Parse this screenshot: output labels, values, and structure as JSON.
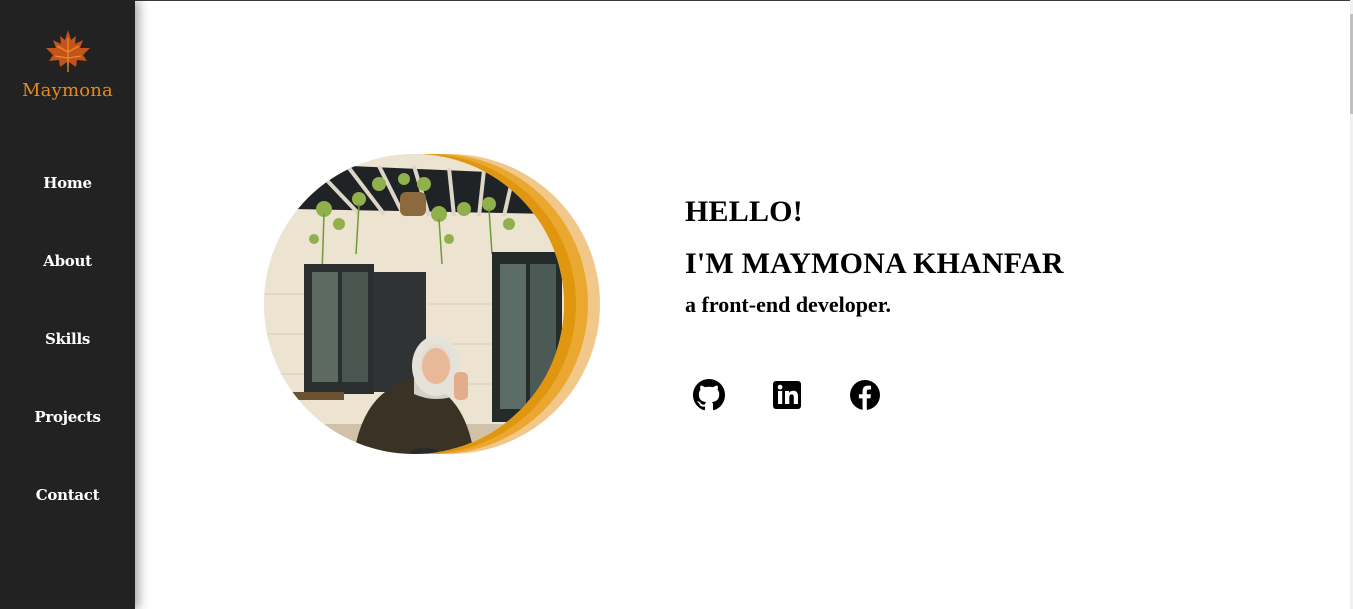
{
  "brand": {
    "name": "Maymona",
    "logo_icon": "maple-leaf-icon",
    "color": "#e8891a"
  },
  "nav": {
    "items": [
      {
        "label": "Home"
      },
      {
        "label": "About"
      },
      {
        "label": "Skills"
      },
      {
        "label": "Projects"
      },
      {
        "label": "Contact"
      }
    ]
  },
  "hero": {
    "greeting": "HELLO!",
    "name": "I'M MAYMONA KHANFAR",
    "role": "a front-end developer.",
    "photo_icon": "profile-photo",
    "accent_colors": [
      "#e0960f",
      "#eba830",
      "#f2c78a"
    ]
  },
  "socials": [
    {
      "icon": "github-icon"
    },
    {
      "icon": "linkedin-icon"
    },
    {
      "icon": "facebook-icon"
    }
  ],
  "colors": {
    "sidebar": "#222222",
    "background": "#ffffff",
    "text": "#000000"
  }
}
